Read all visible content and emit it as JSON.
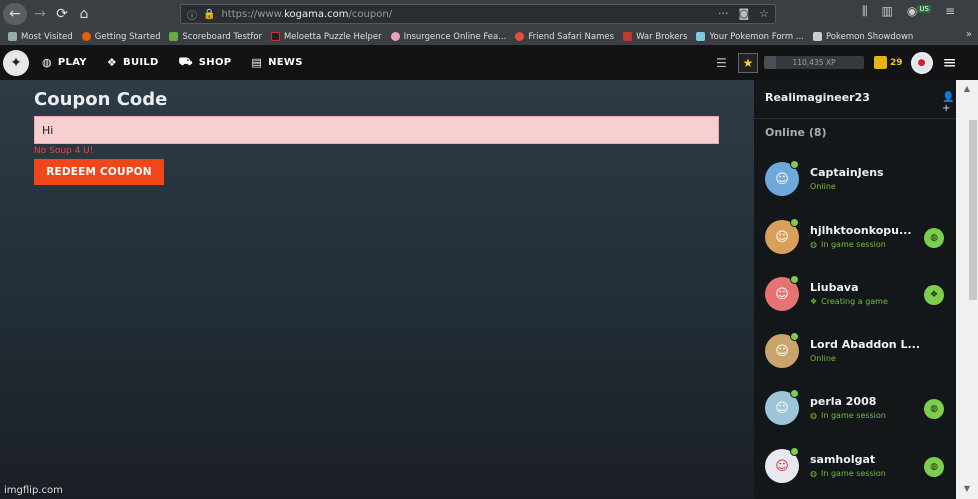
{
  "browser": {
    "url_proto": "https://www.",
    "url_host": "kogama.com",
    "url_path": "/coupon/",
    "extension_badge": "US",
    "bookmarks": [
      {
        "label": "Most Visited",
        "icon_color": "#9aa"
      },
      {
        "label": "Getting Started",
        "icon_color": "#e66000"
      },
      {
        "label": "Scoreboard Testfor",
        "icon_color": "#6a4"
      },
      {
        "label": "Meloetta Puzzle Helper",
        "icon_color": "#222"
      },
      {
        "label": "Insurgence Online Fea...",
        "icon_color": "#e8a0c0"
      },
      {
        "label": "Friend Safari Names",
        "icon_color": "#e74c3c"
      },
      {
        "label": "War Brokers",
        "icon_color": "#c0392b"
      },
      {
        "label": "Your Pokemon Form ...",
        "icon_color": "#7ec8e3"
      },
      {
        "label": "Pokemon Showdown",
        "icon_color": "#ccc"
      }
    ]
  },
  "site_nav": {
    "links": [
      {
        "label": "PLAY",
        "icon": "gamepad-icon"
      },
      {
        "label": "BUILD",
        "icon": "cubes-icon"
      },
      {
        "label": "SHOP",
        "icon": "cart-icon"
      },
      {
        "label": "NEWS",
        "icon": "news-icon"
      }
    ],
    "xp_text": "110,435 XP",
    "gold": "29"
  },
  "main": {
    "title": "Coupon Code",
    "input_value": "Hi",
    "error": "No Soup 4 U!",
    "redeem_label": "REDEEM COUPON",
    "watermark": "imgflip.com"
  },
  "friends": {
    "username": "Realimagineer23",
    "online_header": "Online (8)",
    "list": [
      {
        "name": "CaptainJens",
        "status": "Online",
        "status_icon": "",
        "join": false,
        "avatar_color": "#6fa8dc"
      },
      {
        "name": "hjlhktoonkopu...",
        "status": "In game session",
        "status_icon": "gamepad-icon",
        "join": true,
        "avatar_color": "#d9a05b"
      },
      {
        "name": "Liubava",
        "status": "Creating a game",
        "status_icon": "cubes-icon",
        "join": true,
        "avatar_color": "#e57373"
      },
      {
        "name": "Lord Abaddon L...",
        "status": "Online",
        "status_icon": "",
        "join": false,
        "avatar_color": "#c9a56b"
      },
      {
        "name": "perla 2008",
        "status": "In game session",
        "status_icon": "gamepad-icon",
        "join": true,
        "avatar_color": "#9ec4d9"
      },
      {
        "name": "samholgat",
        "status": "In game session",
        "status_icon": "gamepad-icon",
        "join": true,
        "avatar_color": "#e8e8f0"
      }
    ]
  }
}
